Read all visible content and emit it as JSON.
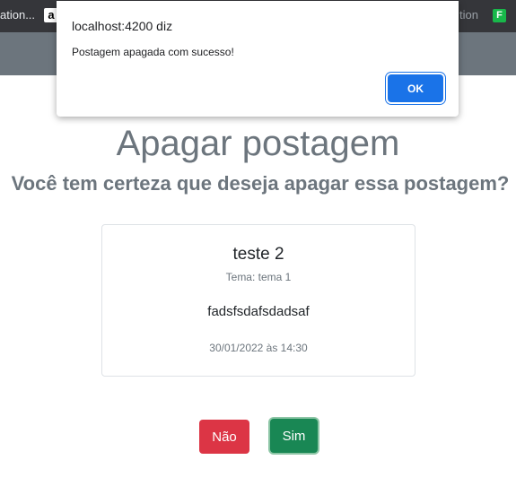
{
  "browser": {
    "bookmarks": {
      "left_label": "ation...",
      "amazon_glyph": "a",
      "right_label": "tion",
      "right_glyph": "F"
    }
  },
  "page": {
    "title": "Apagar postagem",
    "subtitle": "Você tem certeza que deseja apagar essa postagem?"
  },
  "post": {
    "title": "teste 2",
    "theme": "Tema: tema 1",
    "text": "fadsfsdafsdadsaf",
    "date": "30/01/2022 às 14:30"
  },
  "actions": {
    "no_label": "Não",
    "yes_label": "Sim"
  },
  "dialog": {
    "origin": "localhost:4200 diz",
    "message": "Postagem apagada com sucesso!",
    "ok_label": "OK"
  },
  "colors": {
    "navbar": "#6c757d",
    "danger": "#dc3545",
    "success": "#198754",
    "dialog_button": "#1a73e8"
  }
}
